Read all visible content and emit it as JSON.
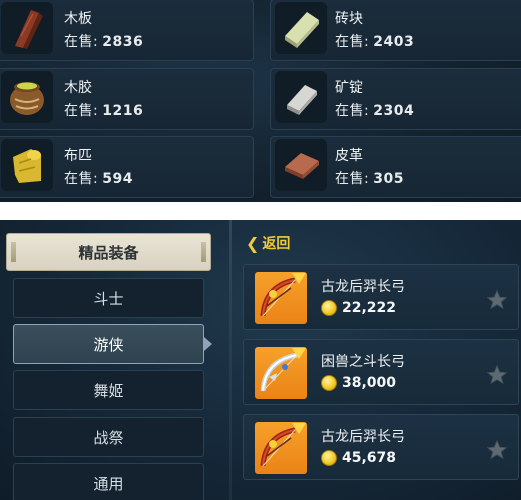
{
  "materials": [
    {
      "name": "木板",
      "stock_label": "在售:",
      "stock": "2836",
      "icon": "wood-plank-icon"
    },
    {
      "name": "砖块",
      "stock_label": "在售:",
      "stock": "2403",
      "icon": "brick-icon"
    },
    {
      "name": "木胶",
      "stock_label": "在售:",
      "stock": "1216",
      "icon": "wood-glue-icon"
    },
    {
      "name": "矿锭",
      "stock_label": "在售:",
      "stock": "2304",
      "icon": "ingot-icon"
    },
    {
      "name": "布匹",
      "stock_label": "在售:",
      "stock": "594",
      "icon": "cloth-icon"
    },
    {
      "name": "皮革",
      "stock_label": "在售:",
      "stock": "305",
      "icon": "leather-icon"
    }
  ],
  "shop": {
    "featured_label": "精品装备",
    "categories": [
      {
        "label": "斗士",
        "selected": false
      },
      {
        "label": "游侠",
        "selected": true
      },
      {
        "label": "舞姬",
        "selected": false
      },
      {
        "label": "战祭",
        "selected": false
      },
      {
        "label": "通用",
        "selected": false
      }
    ],
    "back_label": "返回",
    "items": [
      {
        "name": "古龙后羿长弓",
        "price": "22,222",
        "icon": "bow-icon"
      },
      {
        "name": "困兽之斗长弓",
        "price": "38,000",
        "icon": "bow-icon"
      },
      {
        "name": "古龙后羿长弓",
        "price": "45,678",
        "icon": "bow-icon"
      }
    ]
  },
  "colors": {
    "accent_gold": "#f2cb3a",
    "item_icon_bg": "#f6a12a",
    "panel_bg": "#16293a"
  }
}
